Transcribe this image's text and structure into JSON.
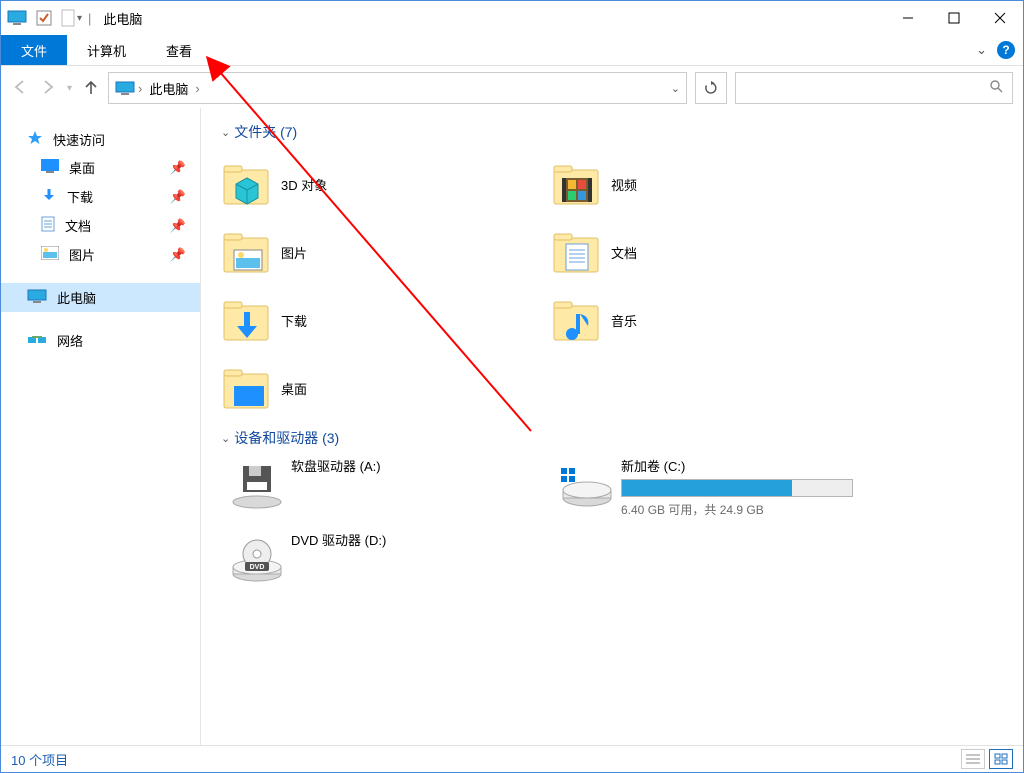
{
  "window": {
    "title": "此电脑",
    "quick_checked": true
  },
  "ribbon": {
    "file": "文件",
    "computer": "计算机",
    "view": "查看"
  },
  "breadcrumb": {
    "root": "此电脑"
  },
  "nav": {
    "quick_access": "快速访问",
    "items": [
      {
        "label": "桌面"
      },
      {
        "label": "下载"
      },
      {
        "label": "文档"
      },
      {
        "label": "图片"
      }
    ],
    "this_pc": "此电脑",
    "network": "网络"
  },
  "sections": {
    "folders_head": "文件夹 (7)",
    "drives_head": "设备和驱动器 (3)"
  },
  "folders": {
    "left": [
      {
        "label": "3D 对象"
      },
      {
        "label": "图片"
      },
      {
        "label": "下载"
      },
      {
        "label": "桌面"
      }
    ],
    "right": [
      {
        "label": "视频"
      },
      {
        "label": "文档"
      },
      {
        "label": "音乐"
      }
    ]
  },
  "drives": [
    {
      "label": "软盘驱动器 (A:)",
      "has_bar": false
    },
    {
      "label": "新加卷 (C:)",
      "has_bar": true,
      "fill_pct": 74,
      "sub": "6.40 GB 可用，共 24.9 GB"
    },
    {
      "label": "DVD 驱动器 (D:)",
      "has_bar": false
    }
  ],
  "status": {
    "item_count": "10 个项目"
  }
}
